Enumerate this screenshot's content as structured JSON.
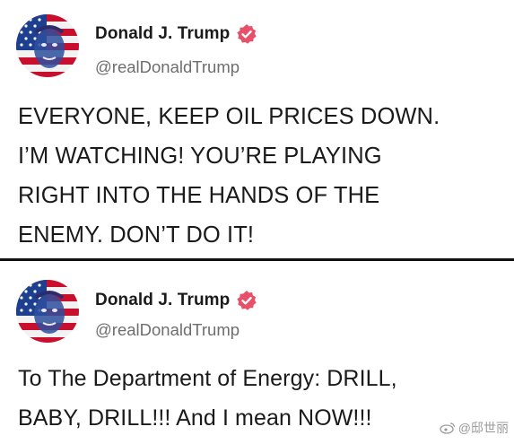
{
  "posts": [
    {
      "author": {
        "name": "Donald J. Trump",
        "handle": "@realDonaldTrump",
        "avatar_icon": "flag-portrait-avatar",
        "badge_icon": "verified-badge-icon",
        "badge_color": "#e8506a"
      },
      "body": [
        "EVERYONE, KEEP OIL PRICES DOWN.",
        "I’M WATCHING! YOU’RE PLAYING",
        "RIGHT INTO THE HANDS OF THE",
        "ENEMY. DON’T DO IT!"
      ]
    },
    {
      "author": {
        "name": "Donald J. Trump",
        "handle": "@realDonaldTrump",
        "avatar_icon": "flag-portrait-avatar",
        "badge_icon": "verified-badge-icon",
        "badge_color": "#e8506a"
      },
      "body": [
        "To The Department of Energy: DRILL,",
        "BABY, DRILL!!!  And I mean NOW!!!"
      ]
    }
  ],
  "watermark": {
    "icon": "weibo-icon",
    "text": "@邸世丽"
  }
}
